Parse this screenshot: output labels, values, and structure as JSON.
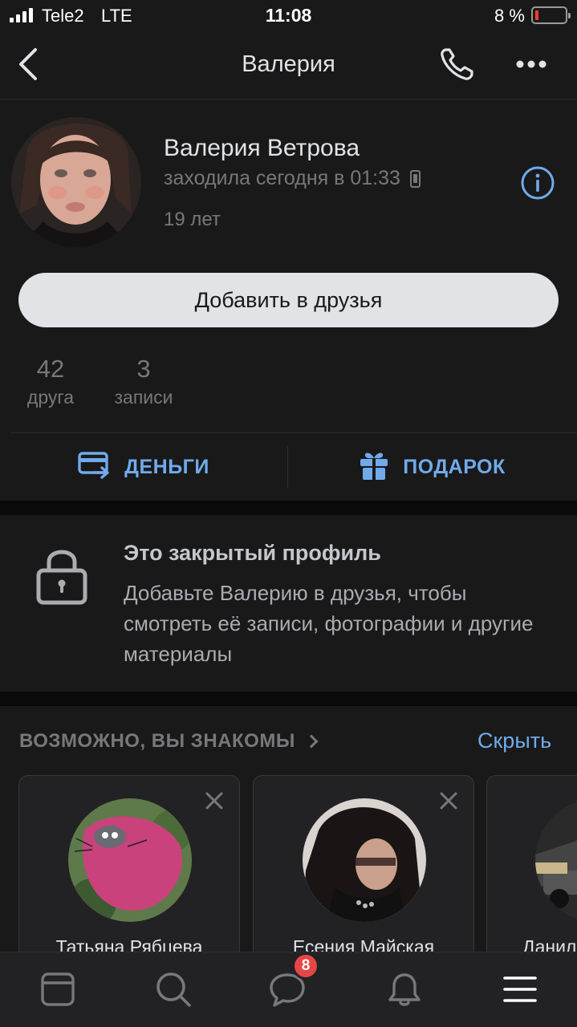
{
  "status_bar": {
    "carrier": "Tele2",
    "network": "LTE",
    "time": "11:08",
    "battery_percent": "8 %",
    "battery_level": 0.08
  },
  "nav": {
    "title": "Валерия",
    "back_icon": "chevron-left-icon",
    "call_icon": "phone-icon",
    "more_icon": "more-horizontal-icon"
  },
  "profile": {
    "name": "Валерия Ветрова",
    "last_seen": "заходила сегодня в 01:33",
    "age": "19 лет",
    "add_friend_label": "Добавить в друзья",
    "counters": [
      {
        "value": "42",
        "label": "друга"
      },
      {
        "value": "3",
        "label": "записи"
      }
    ],
    "actions": {
      "money_label": "ДЕНЬГИ",
      "gift_label": "ПОДАРОК"
    }
  },
  "closed_profile": {
    "title": "Это закрытый профиль",
    "text": "Добавьте Валерию в друзья, чтобы смотреть её записи, фотографии и другие материалы"
  },
  "suggestions": {
    "title": "ВОЗМОЖНО, ВЫ ЗНАКОМЫ",
    "hide_label": "Скрыть",
    "items": [
      {
        "name": "Татьяна Рябцева"
      },
      {
        "name": "Есения Майская"
      },
      {
        "name": "Данил"
      }
    ]
  },
  "tab_bar": {
    "messages_badge": "8",
    "tabs": [
      "news-icon",
      "search-icon",
      "messages-icon",
      "notifications-icon",
      "menu-icon"
    ]
  },
  "colors": {
    "background": "#19191a",
    "accent": "#71aaeb",
    "badge": "#e64646",
    "button": "#e1e3e6"
  }
}
